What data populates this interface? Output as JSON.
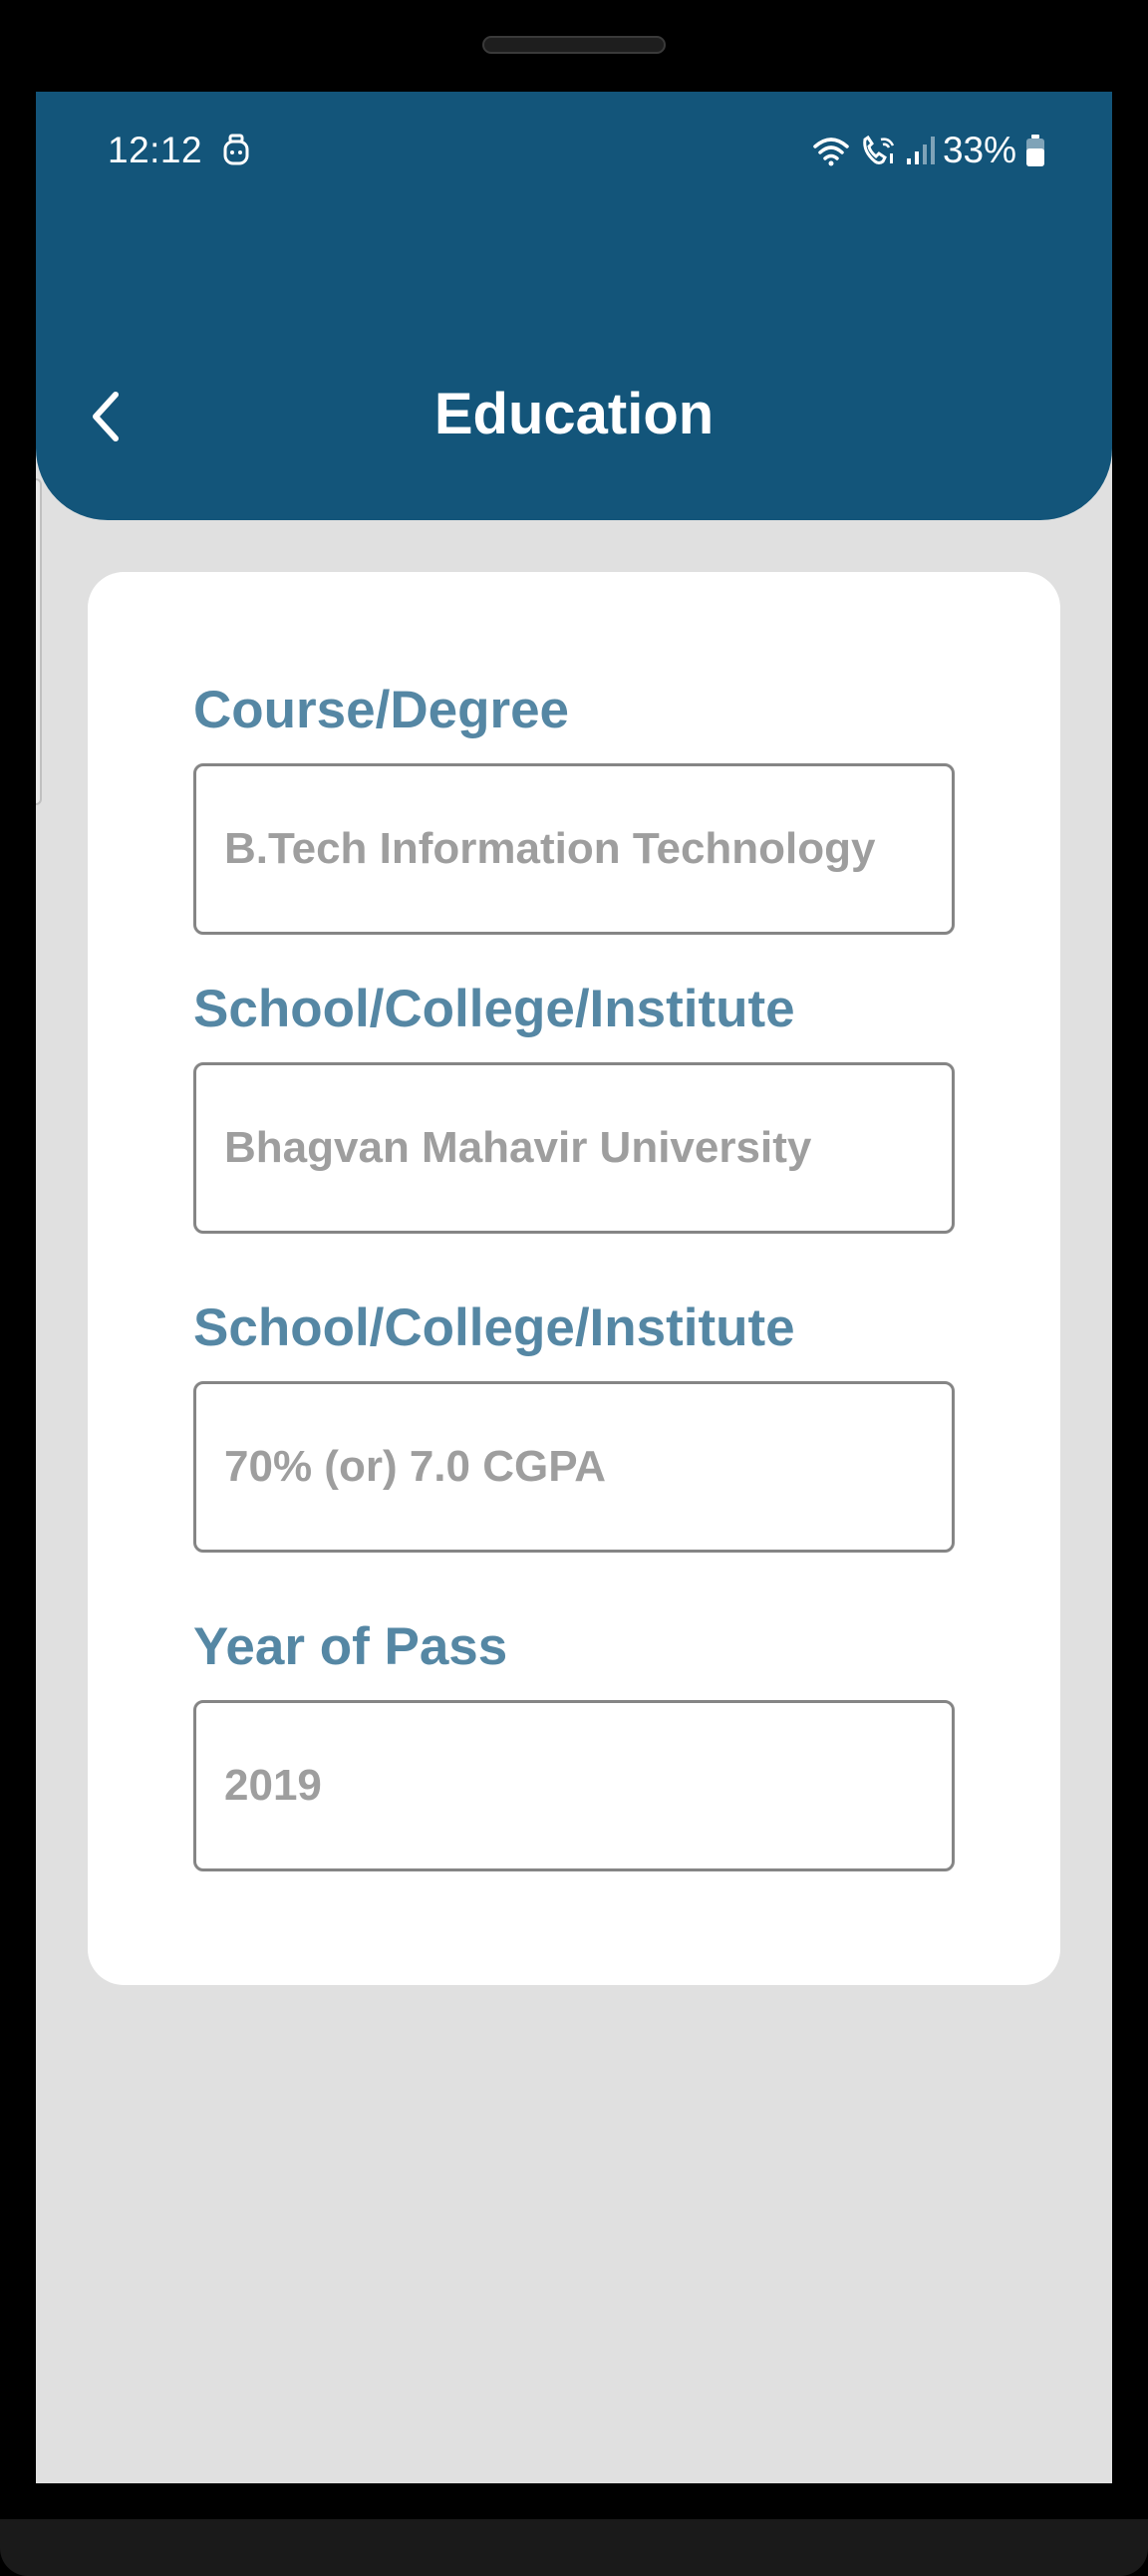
{
  "status_bar": {
    "time": "12:12",
    "battery": "33%"
  },
  "header": {
    "title": "Education"
  },
  "form": {
    "fields": [
      {
        "label": "Course/Degree",
        "placeholder": "B.Tech Information Technology"
      },
      {
        "label": "School/College/Institute",
        "placeholder": "Bhagvan Mahavir University"
      },
      {
        "label": "School/College/Institute",
        "placeholder": "70% (or) 7.0 CGPA"
      },
      {
        "label": "Year of Pass",
        "placeholder": "2019"
      }
    ]
  },
  "colors": {
    "header_bg": "#13557a",
    "label": "#5587a4",
    "placeholder": "#9e9e9e",
    "screen_bg": "#e0e0e0"
  },
  "icons": {
    "back": "chevron-left-icon",
    "notification": "app-notification-icon",
    "wifi": "wifi-icon",
    "call": "wifi-call-icon",
    "signal": "signal-icon",
    "battery": "battery-icon"
  }
}
